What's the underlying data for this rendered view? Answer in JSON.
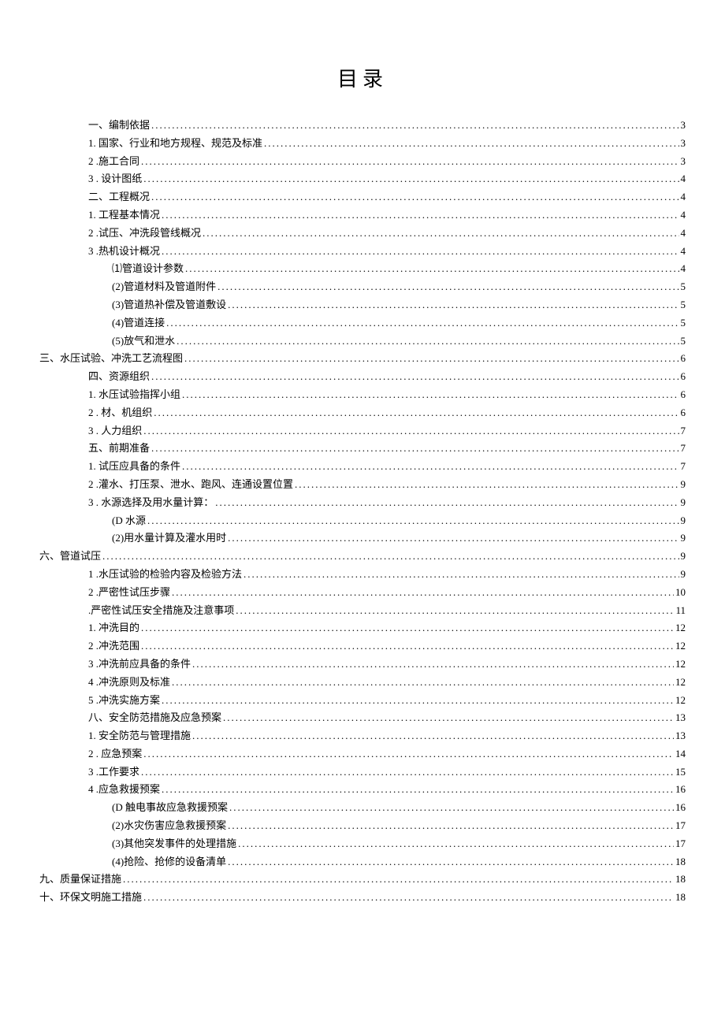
{
  "title": "目录",
  "toc": [
    {
      "lvl": 1,
      "label": "一、编制依据",
      "page": "3"
    },
    {
      "lvl": 1,
      "label": "1. 国家、行业和地方规程、规范及标准",
      "page": "3"
    },
    {
      "lvl": 1,
      "label": "2   .施工合同",
      "page": "3"
    },
    {
      "lvl": 1,
      "label": "3   . 设计图纸",
      "page": "4"
    },
    {
      "lvl": 1,
      "label": "二、工程概况",
      "page": "4"
    },
    {
      "lvl": 1,
      "label": "1. 工程基本情况",
      "page": "4"
    },
    {
      "lvl": 1,
      "label": "2   .试压、冲洗段管线概况",
      "page": "4"
    },
    {
      "lvl": 1,
      "label": "3   .热机设计概况",
      "page": "4"
    },
    {
      "lvl": 2,
      "label": "⑴管道设计参数",
      "page": "4"
    },
    {
      "lvl": 2,
      "label": "(2)管道材料及管道附件",
      "page": "5"
    },
    {
      "lvl": 2,
      "label": "(3)管道热补偿及管道敷设",
      "page": "5"
    },
    {
      "lvl": 2,
      "label": "(4)管道连接",
      "page": "5"
    },
    {
      "lvl": 2,
      "label": "(5)放气和泄水",
      "page": "5"
    },
    {
      "lvl": 0,
      "label": "三、水压试验、冲洗工艺流程图",
      "page": "6"
    },
    {
      "lvl": 1,
      "label": "四、资源组织",
      "page": "6"
    },
    {
      "lvl": 1,
      "label": "1. 水压试验指挥小组",
      "page": "6"
    },
    {
      "lvl": 1,
      "label": "2   . 材、机组织",
      "page": "6"
    },
    {
      "lvl": 1,
      "label": "3   . 人力组织",
      "page": "7"
    },
    {
      "lvl": 1,
      "label": "五、前期准备",
      "page": "7"
    },
    {
      "lvl": 1,
      "label": "1. 试压应具备的条件",
      "page": "7"
    },
    {
      "lvl": 1,
      "label": "2   .灌水、打压泵、泄水、跑风、连通设置位置",
      "page": "9"
    },
    {
      "lvl": 1,
      "label": "3   . 水源选择及用水量计算：",
      "page": "9"
    },
    {
      "lvl": 2,
      "label": "(D 水源",
      "page": "9"
    },
    {
      "lvl": 2,
      "label": "(2)用水量计算及灌水用时",
      "page": "9"
    },
    {
      "lvl": 0,
      "label": "六、管道试压",
      "page": "9"
    },
    {
      "lvl": 1,
      "label": "1   .水压试验的检验内容及检验方法",
      "page": "9"
    },
    {
      "lvl": 1,
      "label": "2   .严密性试压步骤",
      "page": "10"
    },
    {
      "lvl": 1,
      "label": ".严密性试压安全措施及注意事项",
      "page": "11"
    },
    {
      "lvl": 1,
      "label": "1. 冲洗目的",
      "page": "12"
    },
    {
      "lvl": 1,
      "label": "2   .冲洗范围",
      "page": "12"
    },
    {
      "lvl": 1,
      "label": "3   .冲洗前应具备的条件",
      "page": "12"
    },
    {
      "lvl": 1,
      "label": "4   .冲洗原则及标准",
      "page": "12"
    },
    {
      "lvl": 1,
      "label": "5   .冲洗实施方案",
      "page": "12"
    },
    {
      "lvl": 1,
      "label": "八、安全防范措施及应急预案",
      "page": "13"
    },
    {
      "lvl": 1,
      "label": "1. 安全防范与管理措施",
      "page": "13"
    },
    {
      "lvl": 1,
      "label": "2   . 应急预案",
      "page": "14"
    },
    {
      "lvl": 1,
      "label": "3   .工作要求",
      "page": "15"
    },
    {
      "lvl": 1,
      "label": "4   .应急救援预案",
      "page": "16"
    },
    {
      "lvl": 2,
      "label": "(D 触电事故应急救援预案",
      "page": "16"
    },
    {
      "lvl": 2,
      "label": "(2)水灾伤害应急救援预案",
      "page": "17"
    },
    {
      "lvl": 2,
      "label": "(3)其他突发事件的处理措施",
      "page": "17"
    },
    {
      "lvl": 2,
      "label": "(4)抢险、抢修的设备清单",
      "page": "18"
    },
    {
      "lvl": 0,
      "label": "九、质量保证措施",
      "page": "18"
    },
    {
      "lvl": 0,
      "label": "十、环保文明施工措施",
      "page": "18"
    }
  ]
}
